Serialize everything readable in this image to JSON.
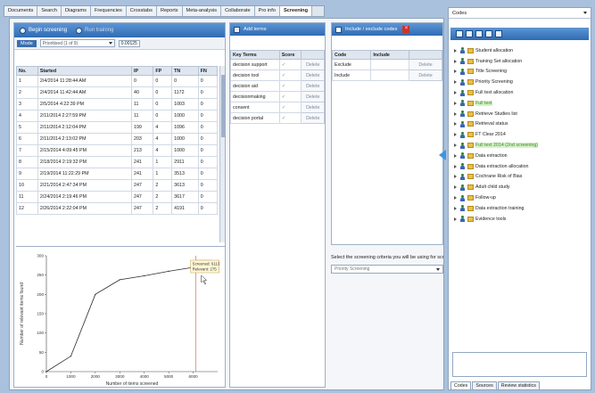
{
  "tabs": [
    {
      "label": "Documents",
      "active": false
    },
    {
      "label": "Search",
      "active": false
    },
    {
      "label": "Diagrams",
      "active": false
    },
    {
      "label": "Frequencies",
      "active": false
    },
    {
      "label": "Crosstabs",
      "active": false
    },
    {
      "label": "Reports",
      "active": false
    },
    {
      "label": "Meta-analysis",
      "active": false
    },
    {
      "label": "Collaborate",
      "active": false
    },
    {
      "label": "Pro info",
      "active": false
    },
    {
      "label": "Screening",
      "active": true
    }
  ],
  "left": {
    "begin_label": "Begin screening",
    "run_label": "Run training",
    "mode_label": "Mode",
    "mode_value": "Prioritised (1 of 9)",
    "threshold": "0.00125",
    "columns": [
      "No.",
      "Started",
      "IP",
      "FP",
      "TN",
      "FN"
    ],
    "rows": [
      [
        "1",
        "2/4/2014 11:28:44 AM",
        "0",
        "0",
        "0",
        "0"
      ],
      [
        "2",
        "2/4/2014 11:42:44 AM",
        "40",
        "0",
        "1172",
        "0"
      ],
      [
        "3",
        "2/5/2014 4:22:39 PM",
        "11",
        "0",
        "1003",
        "0"
      ],
      [
        "4",
        "2/11/2014 2:27:59 PM",
        "11",
        "0",
        "1000",
        "0"
      ],
      [
        "5",
        "2/11/2014 2:12:04 PM",
        "199",
        "4",
        "1096",
        "0"
      ],
      [
        "6",
        "2/11/2014 2:13:02 PM",
        "203",
        "4",
        "1000",
        "0"
      ],
      [
        "7",
        "2/15/2014 4:09:45 PM",
        "213",
        "4",
        "1000",
        "0"
      ],
      [
        "8",
        "2/18/2014 2:19:32 PM",
        "241",
        "1",
        "2911",
        "0"
      ],
      [
        "9",
        "2/19/2014 11:22:29 PM",
        "241",
        "1",
        "3513",
        "0"
      ],
      [
        "10",
        "2/21/2014 2:47:34 PM",
        "247",
        "2",
        "3613",
        "0"
      ],
      [
        "11",
        "2/24/2014 2:19:46 PM",
        "247",
        "2",
        "3617",
        "0"
      ],
      [
        "12",
        "2/26/2014 2:22:04 PM",
        "247",
        "2",
        "4191",
        "0"
      ]
    ]
  },
  "keywords": {
    "add_label": "Add terms",
    "col_term": "Key Terms",
    "col_score": "Score",
    "delete_label": "Delete",
    "items": [
      {
        "term": "decision support"
      },
      {
        "term": "decision tool"
      },
      {
        "term": "decision aid"
      },
      {
        "term": "decisionmaking"
      },
      {
        "term": "consent"
      },
      {
        "term": "decision portal"
      }
    ]
  },
  "codes_panel": {
    "title": "Include / exclude codes",
    "col_code": "Code",
    "col_include": "Include",
    "rows": [
      {
        "code": "Exclude"
      },
      {
        "code": "Include"
      }
    ]
  },
  "criteria": {
    "label": "Select the screening criteria you will be using for screening",
    "value": "Priority Screening"
  },
  "right": {
    "select_value": "Codes",
    "tree": [
      {
        "label": "Student allocation",
        "hl": false
      },
      {
        "label": "Training Set allocation",
        "hl": false
      },
      {
        "label": "Title Screening",
        "hl": false
      },
      {
        "label": "Priority Screening",
        "hl": false
      },
      {
        "label": "Full text allocation",
        "hl": false
      },
      {
        "label": "Full text",
        "hl": true
      },
      {
        "label": "Retrieve Studies list",
        "hl": false
      },
      {
        "label": "Retrieval status",
        "hl": false
      },
      {
        "label": "FT Clear 2014",
        "hl": false
      },
      {
        "label": "Full text 2014 (2nd screening)",
        "hl": true
      },
      {
        "label": "Data extraction",
        "hl": false
      },
      {
        "label": "Data extraction allocation",
        "hl": false
      },
      {
        "label": "Cochrane Risk of Bias",
        "hl": false
      },
      {
        "label": "Adult child study",
        "hl": false
      },
      {
        "label": "Follow-up",
        "hl": false
      },
      {
        "label": "Data extraction training",
        "hl": false
      },
      {
        "label": "Evidence tools",
        "hl": false
      }
    ],
    "bottom_tabs": [
      {
        "label": "Codes",
        "active": true
      },
      {
        "label": "Sources",
        "active": false
      },
      {
        "label": "Review statistics",
        "active": false
      }
    ]
  },
  "chart_data": {
    "type": "line",
    "x": [
      0,
      1000,
      2000,
      3000,
      4000,
      5000,
      6000,
      7000
    ],
    "y": [
      0,
      40,
      200,
      238,
      248,
      260,
      270,
      275
    ],
    "xlabel": "Number of items screened",
    "ylabel": "Number of relevant items found",
    "xlim": [
      0,
      7000
    ],
    "ylim": [
      0,
      300
    ],
    "x_ticks": [
      "0",
      "1000",
      "2000",
      "3000",
      "4000",
      "5000",
      "6000"
    ],
    "y_ticks": [
      "0",
      "50",
      "100",
      "150",
      "200",
      "250",
      "300"
    ],
    "tooltip": [
      "Screened: 6113",
      "Relevant: 275"
    ],
    "marker_x": 6113,
    "grid": false
  }
}
